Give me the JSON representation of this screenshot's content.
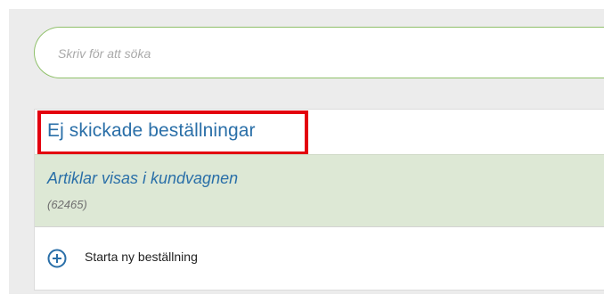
{
  "search": {
    "placeholder": "Skriv för att söka"
  },
  "orders_section": {
    "title": "Ej skickade beställningar",
    "items": [
      {
        "name": "Artiklar visas i kundvagnen",
        "id": "(62465)"
      }
    ],
    "new_order_label": "Starta ny beställning"
  },
  "colors": {
    "accent_blue": "#2a6fa8",
    "search_border_green": "#8fc06a",
    "selected_row_bg": "#dde8d5",
    "highlight_red": "#e3000f",
    "panel_bg": "#ececec"
  },
  "icons": {
    "new_order": "plus-circle-icon"
  }
}
